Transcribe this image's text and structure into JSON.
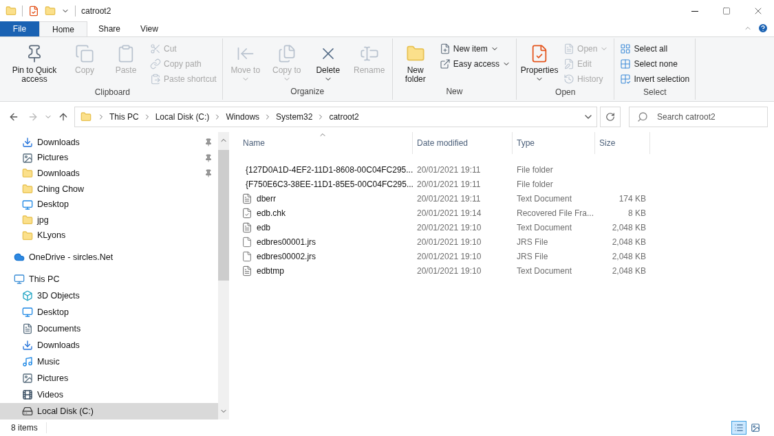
{
  "window": {
    "title": "catroot2"
  },
  "ribbon_tabs": [
    {
      "label": "File",
      "kind": "file",
      "selected": false
    },
    {
      "label": "Home",
      "kind": "tab",
      "selected": true
    },
    {
      "label": "Share",
      "kind": "tab",
      "selected": false
    },
    {
      "label": "View",
      "kind": "tab",
      "selected": false
    }
  ],
  "ribbon_groups": [
    {
      "label": "Clipboard",
      "commands": [
        {
          "label": "Pin to Quick access",
          "kind": "large",
          "disabled": false,
          "dropdown": false
        },
        {
          "label": "Copy",
          "kind": "large",
          "disabled": true,
          "dropdown": false
        },
        {
          "label": "Paste",
          "kind": "large",
          "disabled": true,
          "dropdown": false
        },
        {
          "label": "Cut",
          "kind": "small",
          "disabled": true,
          "dropdown": false
        },
        {
          "label": "Copy path",
          "kind": "small",
          "disabled": true,
          "dropdown": false
        },
        {
          "label": "Paste shortcut",
          "kind": "small",
          "disabled": true,
          "dropdown": false
        }
      ]
    },
    {
      "label": "Organize",
      "commands": [
        {
          "label": "Move to",
          "kind": "large",
          "disabled": true,
          "dropdown": true
        },
        {
          "label": "Copy to",
          "kind": "large",
          "disabled": true,
          "dropdown": true
        },
        {
          "label": "Delete",
          "kind": "large",
          "disabled": false,
          "dropdown": true
        },
        {
          "label": "Rename",
          "kind": "large",
          "disabled": true,
          "dropdown": false
        }
      ]
    },
    {
      "label": "New",
      "commands": [
        {
          "label": "New folder",
          "kind": "large",
          "disabled": false,
          "dropdown": false
        },
        {
          "label": "New item",
          "kind": "small",
          "disabled": false,
          "dropdown": true
        },
        {
          "label": "Easy access",
          "kind": "small",
          "disabled": false,
          "dropdown": true
        }
      ]
    },
    {
      "label": "Open",
      "commands": [
        {
          "label": "Properties",
          "kind": "large",
          "disabled": false,
          "dropdown": true
        },
        {
          "label": "Open",
          "kind": "small",
          "disabled": true,
          "dropdown": true
        },
        {
          "label": "Edit",
          "kind": "small",
          "disabled": true,
          "dropdown": false
        },
        {
          "label": "History",
          "kind": "small",
          "disabled": true,
          "dropdown": false
        }
      ]
    },
    {
      "label": "Select",
      "commands": [
        {
          "label": "Select all",
          "kind": "small",
          "disabled": false,
          "dropdown": false
        },
        {
          "label": "Select none",
          "kind": "small",
          "disabled": false,
          "dropdown": false
        },
        {
          "label": "Invert selection",
          "kind": "small",
          "disabled": false,
          "dropdown": false
        }
      ]
    }
  ],
  "breadcrumb": [
    "This PC",
    "Local Disk (C:)",
    "Windows",
    "System32",
    "catroot2"
  ],
  "search": {
    "placeholder": "Search catroot2"
  },
  "sidebar": {
    "quick_access": [
      {
        "label": "Downloads",
        "kind": "downloads",
        "pinned": true,
        "selected": false
      },
      {
        "label": "Pictures",
        "kind": "pictures",
        "pinned": true,
        "selected": false
      },
      {
        "label": "Downloads",
        "kind": "folder",
        "pinned": true,
        "selected": false
      },
      {
        "label": "Ching Chow",
        "kind": "folder",
        "pinned": false,
        "selected": false
      },
      {
        "label": "Desktop",
        "kind": "desktop",
        "pinned": false,
        "selected": false
      },
      {
        "label": "jpg",
        "kind": "folder",
        "pinned": false,
        "selected": false
      },
      {
        "label": "KLyons",
        "kind": "folder",
        "pinned": false,
        "selected": false
      }
    ],
    "nodes": [
      {
        "label": "OneDrive - sircles.Net",
        "kind": "cloud",
        "selected": false
      },
      {
        "label": "This PC",
        "kind": "pc",
        "selected": false,
        "children": [
          {
            "label": "3D Objects",
            "kind": "cube",
            "selected": false
          },
          {
            "label": "Desktop",
            "kind": "desktop",
            "selected": false
          },
          {
            "label": "Documents",
            "kind": "documents",
            "selected": false
          },
          {
            "label": "Downloads",
            "kind": "downloads",
            "selected": false
          },
          {
            "label": "Music",
            "kind": "music",
            "selected": false
          },
          {
            "label": "Pictures",
            "kind": "pictures",
            "selected": false
          },
          {
            "label": "Videos",
            "kind": "videos",
            "selected": false
          },
          {
            "label": "Local Disk (C:)",
            "kind": "disk",
            "selected": true
          }
        ]
      }
    ]
  },
  "table": {
    "columns": [
      {
        "label": "Name",
        "sorted": true
      },
      {
        "label": "Date modified",
        "sorted": false
      },
      {
        "label": "Type",
        "sorted": false
      },
      {
        "label": "Size",
        "sorted": false
      }
    ],
    "rows": [
      {
        "name": "{127D0A1D-4EF2-11D1-8608-00C04FC295...",
        "date": "20/01/2021 19:11",
        "type": "File folder",
        "size": "",
        "kind": "folder"
      },
      {
        "name": "{F750E6C3-38EE-11D1-85E5-00C04FC295...",
        "date": "20/01/2021 19:11",
        "type": "File folder",
        "size": "",
        "kind": "folder"
      },
      {
        "name": "dberr",
        "date": "20/01/2021 19:11",
        "type": "Text Document",
        "size": "174 KB",
        "kind": "text"
      },
      {
        "name": "edb.chk",
        "date": "20/01/2021 19:14",
        "type": "Recovered File Fra...",
        "size": "8 KB",
        "kind": "recovered"
      },
      {
        "name": "edb",
        "date": "20/01/2021 19:10",
        "type": "Text Document",
        "size": "2,048 KB",
        "kind": "text"
      },
      {
        "name": "edbres00001.jrs",
        "date": "20/01/2021 19:10",
        "type": "JRS File",
        "size": "2,048 KB",
        "kind": "blank"
      },
      {
        "name": "edbres00002.jrs",
        "date": "20/01/2021 19:10",
        "type": "JRS File",
        "size": "2,048 KB",
        "kind": "blank"
      },
      {
        "name": "edbtmp",
        "date": "20/01/2021 19:10",
        "type": "Text Document",
        "size": "2,048 KB",
        "kind": "text"
      }
    ]
  },
  "status_bar": {
    "item_count": "8 items",
    "view_modes": [
      {
        "kind": "details",
        "selected": true
      },
      {
        "kind": "thumbnails",
        "selected": false
      }
    ]
  }
}
